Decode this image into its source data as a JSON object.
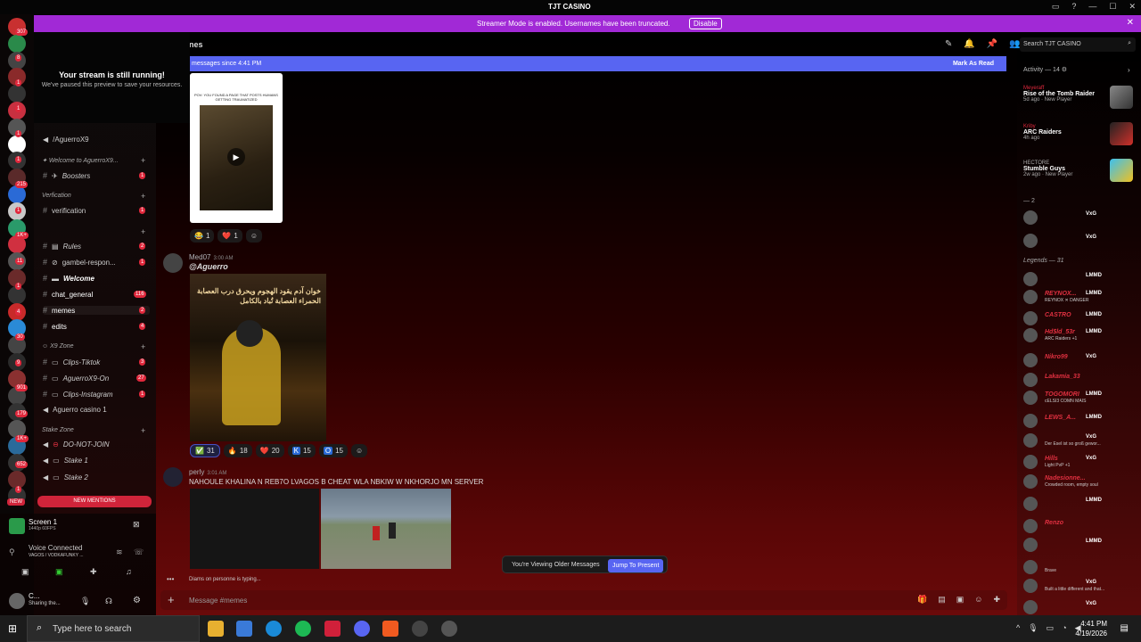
{
  "window": {
    "title": "TJT CASINO"
  },
  "streamer": {
    "message": "Streamer Mode is enabled. Usernames have been truncated.",
    "disable_label": "Disable"
  },
  "stream_popup": {
    "title": "Your stream is still running!",
    "subtitle": "We've paused this preview to save your resources."
  },
  "server_badges": [
    "307",
    "8",
    "1",
    "1",
    "1",
    "1",
    "215",
    "1",
    "1K+",
    "11",
    "1",
    "4",
    "30",
    "9",
    "901",
    "179",
    "1K+",
    "652",
    "1"
  ],
  "channels": {
    "aguerro": "/AguerroX9",
    "welcome_cat": "Welcome to AguerroX9...",
    "boosters": "Boosters",
    "boosters_count": "1",
    "verification_cat": "Verfication",
    "verification": "verification",
    "verification_count": "1",
    "rules": "Rules",
    "rules_count": "2",
    "gambel": "gambel-respon...",
    "gambel_count": "1",
    "welcome": "Welcome",
    "chat_general": "chat_general",
    "chat_general_count": "116",
    "memes": "memes",
    "memes_count": "2",
    "edits": "edits",
    "edits_count": "4",
    "x9zone_cat": "X9 Zone",
    "clips_tiktok": "Clips-Tiktok",
    "clips_tiktok_count": "3",
    "aguerro_on": "AguerroX9-On",
    "aguerro_on_count": "27",
    "clips_instagram": "Clips-Instagram",
    "clips_instagram_count": "1",
    "aguerro_casino": "Aguerro casino 1",
    "stake_cat": "Stake Zone",
    "do_not_join": "DO-NOT-JOIN",
    "stake1": "Stake 1",
    "stake2": "Stake 2",
    "new_label": "NEW",
    "new_mentions": "NEW MENTIONS"
  },
  "user_panel": {
    "screen": "Screen 1",
    "screen_sub": "1440p 60FPS",
    "voice": "Voice Connected",
    "voice_sub": "VAGOS / VODKAFUNKY ...",
    "user": "C...",
    "user_status": "Sharing the..."
  },
  "header": {
    "channel": "nes",
    "search_placeholder": "Search TJT CASINO"
  },
  "newmsg": {
    "text": "messages since 4:41 PM",
    "mark_read": "Mark As Read"
  },
  "messages": {
    "card_caption": "POV: YOU FOUND A PAGE THAT POSTS HUMANS GETTING TRAUMATIZED",
    "react1": [
      {
        "e": "😂",
        "c": "1"
      },
      {
        "e": "❤️",
        "c": "1"
      }
    ],
    "author2": "Med07",
    "time2": "3:00 AM",
    "mention2": "@Aguerro",
    "poster_title": "خوان آدم يقود الهجوم ويحرق درب العصابة الحمراء العصابة تُباد بالكامل",
    "react2": [
      {
        "e": "✅",
        "c": "31"
      },
      {
        "e": "🔥",
        "c": "18"
      },
      {
        "e": "❤️",
        "c": "20"
      },
      {
        "e": "K",
        "c": "15"
      },
      {
        "e": "O",
        "c": "15"
      }
    ],
    "author3": "perly",
    "time3": "3:01 AM",
    "text3": "NAHOULE KHALINA N REB7O LVAGOS B CHEAT WLA NBKIW W NKHORJO MN SERVER",
    "typing": "Diams on personne is typing..."
  },
  "older": {
    "text": "You're Viewing Older Messages",
    "button": "Jump To Present"
  },
  "composer": {
    "placeholder": "Message #memes"
  },
  "activity": {
    "header": "Activity — 14",
    "items": [
      {
        "name": "Meyeraff",
        "game": "Rise of the Tomb Raider",
        "sub": "5d ago · New Player"
      },
      {
        "name": "Kriby",
        "game": "ARC Raiders",
        "sub": "4h ago"
      },
      {
        "name": "HECTORE",
        "game": "Stumble Guys",
        "sub": "2w ago · New Player"
      }
    ]
  },
  "members": {
    "group1": "— 2",
    "group2": "Legends — 31",
    "list": [
      {
        "n": "",
        "t": "VxG"
      },
      {
        "n": "",
        "t": "VxG"
      },
      {
        "n": "",
        "t": "LMMD"
      },
      {
        "n": "REYNOX...",
        "t": "LMMD",
        "s": "REYNOX ✕ DANGER"
      },
      {
        "n": "CASTRO",
        "t": "LMMD"
      },
      {
        "n": "Hd$ld_53r",
        "t": "LMMD",
        "s": "ARC Raiders +1"
      },
      {
        "n": "Nikro99",
        "t": "VxG"
      },
      {
        "n": "Lakamia_33",
        "t": ""
      },
      {
        "n": "TOGOMORI",
        "t": "LMMD",
        "s": "cELSI3 COMN MAIS"
      },
      {
        "n": "LEWS_A...",
        "t": "LMMD"
      },
      {
        "n": "",
        "t": "VxG",
        "s": "Der Esel ist so groß gewor..."
      },
      {
        "n": "Hills",
        "t": "VxG",
        "s": "Light PvP +1"
      },
      {
        "n": "Nadesionne...",
        "t": "",
        "s": "Crowded room, empty soul"
      },
      {
        "n": "",
        "t": "LMMD"
      },
      {
        "n": "Renzo",
        "t": ""
      },
      {
        "n": "",
        "t": "LMMD"
      },
      {
        "n": "",
        "t": "",
        "s": "Brave"
      },
      {
        "n": "",
        "t": "VxG",
        "s": "Built a little different and that..."
      },
      {
        "n": "",
        "t": "VxG"
      }
    ]
  },
  "taskbar": {
    "search": "Type here to search",
    "time": "4:41 PM",
    "date": "4/19/2026"
  }
}
